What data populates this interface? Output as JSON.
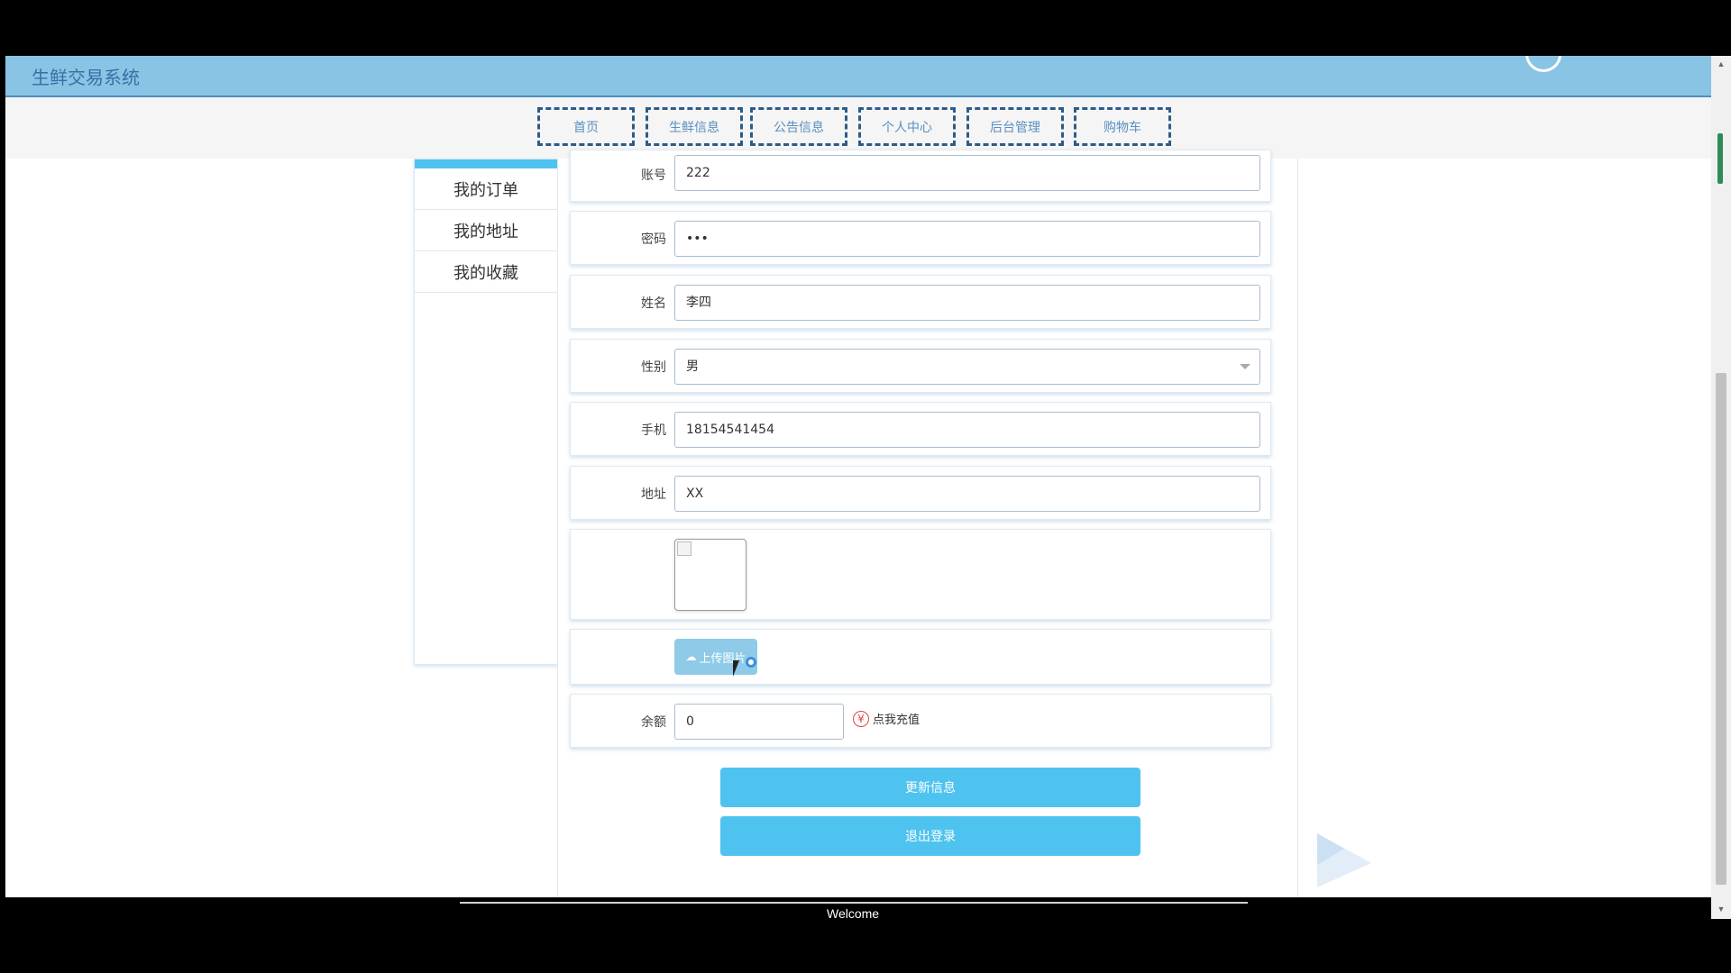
{
  "header": {
    "app_title": "生鲜交易系统"
  },
  "nav": {
    "items": [
      {
        "label": "首页"
      },
      {
        "label": "生鲜信息"
      },
      {
        "label": "公告信息"
      },
      {
        "label": "个人中心"
      },
      {
        "label": "后台管理"
      },
      {
        "label": "购物车"
      }
    ]
  },
  "sidebar": {
    "items": [
      {
        "label": "我的订单"
      },
      {
        "label": "我的地址"
      },
      {
        "label": "我的收藏"
      }
    ]
  },
  "form": {
    "account": {
      "label": "账号",
      "value": "222"
    },
    "password": {
      "label": "密码",
      "value": "•••"
    },
    "name": {
      "label": "姓名",
      "value": "李四"
    },
    "gender": {
      "label": "性别",
      "value": "男"
    },
    "phone": {
      "label": "手机",
      "value": "18154541454"
    },
    "address": {
      "label": "地址",
      "value": "XX"
    },
    "upload": {
      "label": "上传图片",
      "icon": "cloud-upload-icon"
    },
    "balance": {
      "label": "余额",
      "value": "0",
      "recharge_label": "点我充值",
      "recharge_icon_glyph": "¥"
    }
  },
  "actions": {
    "update_label": "更新信息",
    "logout_label": "退出登录"
  },
  "footer": {
    "text": "Welcome"
  },
  "colors": {
    "accent": "#4fc3ef",
    "topbar": "#89c4e4",
    "nav_border": "#2d5b87"
  }
}
